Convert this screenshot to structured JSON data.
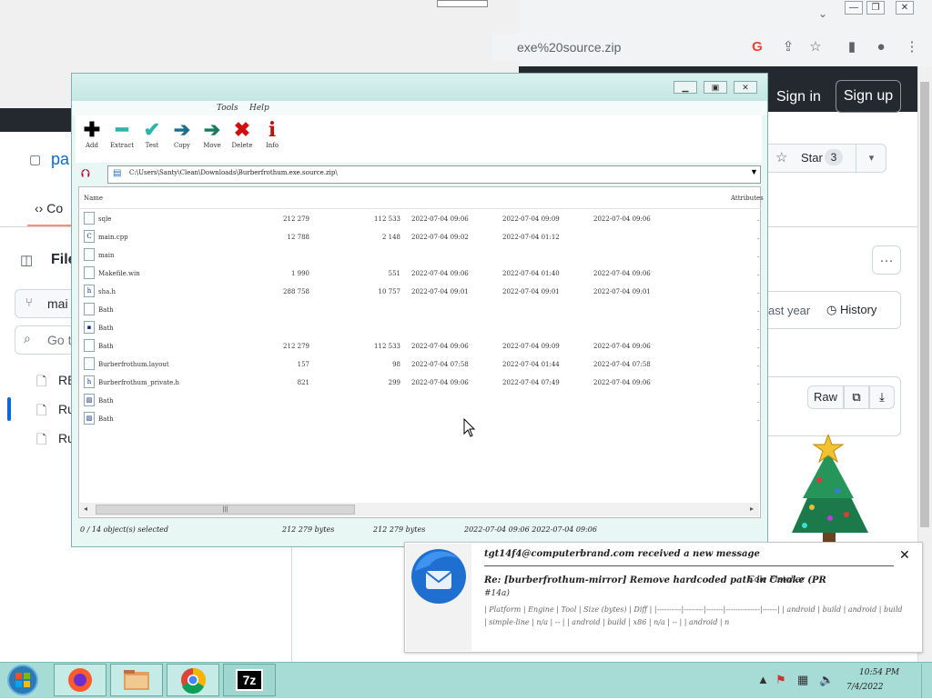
{
  "browser": {
    "address": "exe%20source.zip",
    "tab_chevron": "⌄",
    "controls": {
      "minimize": "—",
      "restore": "❐",
      "close": "✕"
    },
    "icons": [
      "google-icon",
      "share-icon",
      "star-bookmark-icon",
      "sidebar-icon",
      "profile-icon",
      "menu-icon"
    ]
  },
  "github": {
    "sign_in": "Sign in",
    "sign_up": "Sign up",
    "repo_name": "pa",
    "code_tab": "Co",
    "star_label": "Star",
    "star_count": "3",
    "files_title": "File",
    "branch": "mai",
    "goto_placeholder": "Go t",
    "tree": [
      "RE",
      "Ru",
      "Ru"
    ],
    "last_commit": "ast year",
    "history": "History",
    "raw": "Raw"
  },
  "sevenzip": {
    "menu": [
      "Tools",
      "Help"
    ],
    "toolbar": [
      {
        "label": "Add",
        "glyph": "✚",
        "color": "#000000"
      },
      {
        "label": "Extract",
        "glyph": "━",
        "color": "#2bb5a8"
      },
      {
        "label": "Test",
        "glyph": "✔",
        "color": "#2bb5a8"
      },
      {
        "label": "Copy",
        "glyph": "➔",
        "color": "#1b6f8a"
      },
      {
        "label": "Move",
        "glyph": "➔",
        "color": "#1b7a5e"
      },
      {
        "label": "Delete",
        "glyph": "✖",
        "color": "#d01010"
      },
      {
        "label": "Info",
        "glyph": "i",
        "color": "#c01010"
      }
    ],
    "path": "C:\\Users\\Santy\\Clean\\Downloads\\Burberfrothum.exe.source.zip\\",
    "columns": {
      "name": "Name",
      "attributes": "Attributes"
    },
    "rows": [
      {
        "icon": "file-icon",
        "name": "sqle",
        "size": "212 279",
        "packed": "112 533",
        "modified": "2022-07-04 09:06",
        "created": "2022-07-04 09:09",
        "accessed": "2022-07-04 09:06",
        "attr": "."
      },
      {
        "icon": "cpp-file-icon",
        "name": "main.cpp",
        "size": "12 788",
        "packed": "2 148",
        "modified": "2022-07-04 09:02",
        "created": "2022-07-04 01:12",
        "accessed": "",
        "attr": "."
      },
      {
        "icon": "file-icon",
        "name": "main",
        "size": "",
        "packed": "",
        "modified": "",
        "created": "",
        "accessed": "",
        "attr": "."
      },
      {
        "icon": "file-icon",
        "name": "Makefile.win",
        "size": "1 990",
        "packed": "551",
        "modified": "2022-07-04 09:06",
        "created": "2022-07-04 01:40",
        "accessed": "2022-07-04 09:06",
        "attr": "."
      },
      {
        "icon": "header-file-icon",
        "name": "sha.h",
        "size": "288 758",
        "packed": "10 757",
        "modified": "2022-07-04 09:01",
        "created": "2022-07-04 09:01",
        "accessed": "2022-07-04 09:01",
        "attr": "."
      },
      {
        "icon": "file-icon",
        "name": "Bath",
        "size": "",
        "packed": "",
        "modified": "",
        "created": "",
        "accessed": "",
        "attr": "."
      },
      {
        "icon": "image-file-icon",
        "name": "Bath",
        "size": "",
        "packed": "",
        "modified": "",
        "created": "",
        "accessed": "",
        "attr": "."
      },
      {
        "icon": "file-icon",
        "name": "Bath",
        "size": "212 279",
        "packed": "112 533",
        "modified": "2022-07-04 09:06",
        "created": "2022-07-04 09:09",
        "accessed": "2022-07-04 09:06",
        "attr": "."
      },
      {
        "icon": "file-icon",
        "name": "Burberfrothum.layout",
        "size": "157",
        "packed": "98",
        "modified": "2022-07-04 07:58",
        "created": "2022-07-04 01:44",
        "accessed": "2022-07-04 07:58",
        "attr": "."
      },
      {
        "icon": "header-file-icon",
        "name": "Burberfrothum_private.h",
        "size": "821",
        "packed": "299",
        "modified": "2022-07-04 09:06",
        "created": "2022-07-04 07:49",
        "accessed": "2022-07-04 09:06",
        "attr": "."
      },
      {
        "icon": "picture-file-icon",
        "name": "Bath",
        "size": "",
        "packed": "",
        "modified": "",
        "created": "",
        "accessed": "",
        "attr": "."
      },
      {
        "icon": "picture-file-icon",
        "name": "Bath",
        "size": "",
        "packed": "",
        "modified": "",
        "created": "",
        "accessed": "",
        "attr": "."
      }
    ],
    "status": [
      "0 / 14 object(s) selected",
      "212 279 bytes",
      "212 279 bytes",
      "2022-07-04 09:06 2022-07-04 09:06"
    ]
  },
  "notification": {
    "sender": "tgt14f4@computerbrand.com received a new message",
    "subject": "Re: [burberfrothum-mirror] Remove hardcoded path in Cmake (PR",
    "author": "Cole Fletcher",
    "subject2": "#14a)",
    "body": "| Platform | Engine | Tool | Size (bytes) | Diff | |----------|--------|-------|--------------|------| | android | build | android | build | simple-line | n/a | -- | | android | build | x86 | n/a | -- | | android | n"
  },
  "taskbar": {
    "apps": [
      "firefox-icon",
      "file-explorer-icon",
      "chrome-icon",
      "7zip-icon"
    ],
    "sevenzip_label": "7z",
    "time": "10:54 PM",
    "date": "7/4/2022"
  }
}
